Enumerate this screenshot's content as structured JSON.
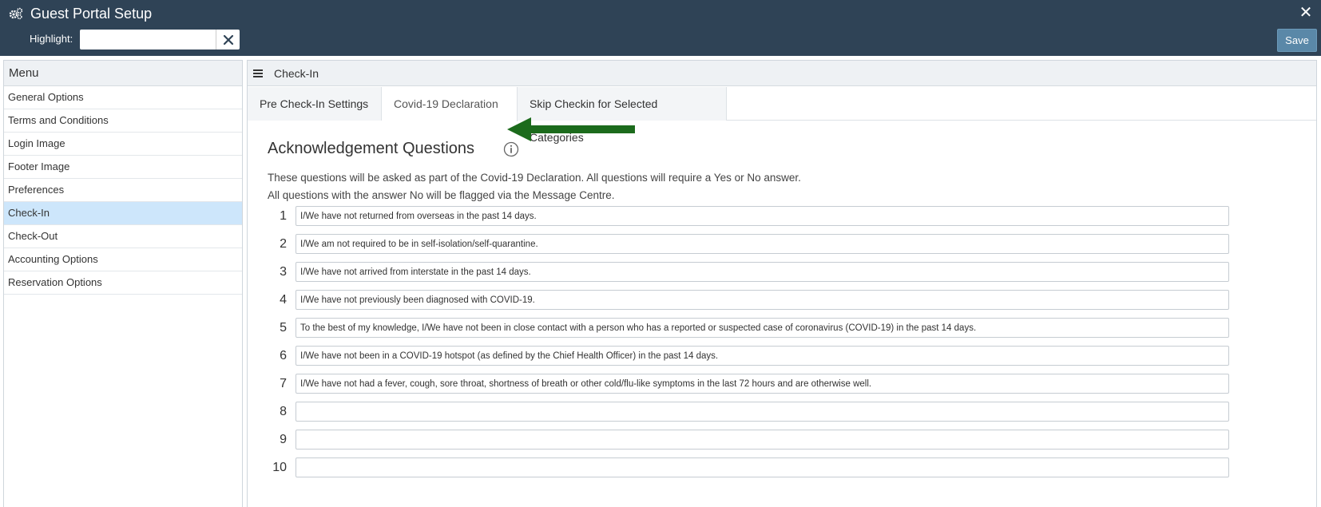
{
  "header": {
    "title": "Guest Portal Setup",
    "app_icon": "gears-icon",
    "close_icon": "close-icon",
    "highlight_label": "Highlight:",
    "highlight_value": "",
    "save_label": "Save"
  },
  "menu": {
    "title": "Menu",
    "items": [
      {
        "label": "General Options"
      },
      {
        "label": "Terms and Conditions"
      },
      {
        "label": "Login Image"
      },
      {
        "label": "Footer Image"
      },
      {
        "label": "Preferences"
      },
      {
        "label": "Check-In"
      },
      {
        "label": "Check-Out"
      },
      {
        "label": "Accounting Options"
      },
      {
        "label": "Reservation Options"
      }
    ],
    "active": "Check-In"
  },
  "main": {
    "title": "Check-In",
    "tabs": [
      {
        "label": "Pre Check-In Settings"
      },
      {
        "label": "Covid-19 Declaration"
      },
      {
        "label": "Skip Checkin for Selected Categories"
      }
    ],
    "active_tab": "Covid-19 Declaration",
    "section_title": "Acknowledgement Questions",
    "description_line1": "These questions will be asked as part of the Covid-19 Declaration. All questions will require a Yes or No answer.",
    "description_line2": "All questions with the answer No will be flagged via the Message Centre.",
    "questions": [
      {
        "num": "1",
        "value": "I/We have not returned from overseas in the past 14 days."
      },
      {
        "num": "2",
        "value": "I/We am not required to be in self-isolation/self-quarantine."
      },
      {
        "num": "3",
        "value": "I/We have not arrived from interstate in the past 14 days."
      },
      {
        "num": "4",
        "value": "I/We have not previously been diagnosed with COVID-19."
      },
      {
        "num": "5",
        "value": "To the best of my knowledge, I/We have not been in close contact with a person who has a reported or suspected case of coronavirus (COVID-19) in the past 14 days."
      },
      {
        "num": "6",
        "value": "I/We have not been in a COVID-19 hotspot (as defined by the Chief Health Officer) in the past 14 days."
      },
      {
        "num": "7",
        "value": "I/We have not had a fever, cough, sore throat, shortness of breath or other cold/flu-like symptoms in the last 72 hours and are otherwise well."
      },
      {
        "num": "8",
        "value": ""
      },
      {
        "num": "9",
        "value": ""
      },
      {
        "num": "10",
        "value": ""
      }
    ]
  },
  "colors": {
    "header_bg": "#2f4356",
    "save_bg": "#5a88a8",
    "active_menu_bg": "#cde6fb",
    "arrow": "#1c6b1c"
  }
}
